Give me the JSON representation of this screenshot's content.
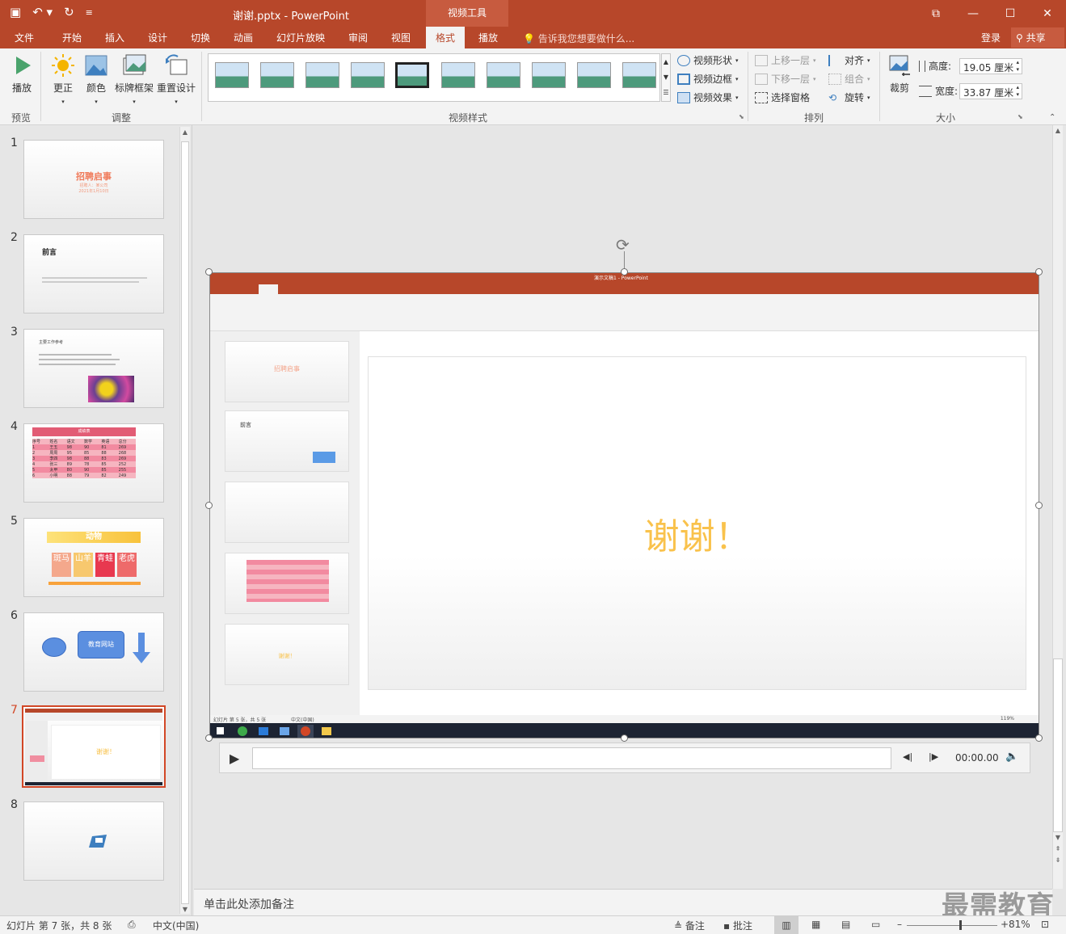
{
  "window": {
    "doc_title": "谢谢.pptx - PowerPoint",
    "context_tab_header": "视频工具",
    "quick_access": [
      "save-icon",
      "undo-icon",
      "redo-icon",
      "customize-icon"
    ],
    "controls": [
      "ribbon-display-icon",
      "minimize-icon",
      "maximize-icon",
      "close-icon"
    ]
  },
  "tabs": [
    {
      "label": "文件"
    },
    {
      "label": "开始"
    },
    {
      "label": "插入"
    },
    {
      "label": "设计"
    },
    {
      "label": "切换"
    },
    {
      "label": "动画"
    },
    {
      "label": "幻灯片放映"
    },
    {
      "label": "审阅"
    },
    {
      "label": "视图"
    },
    {
      "label": "格式",
      "active": true
    },
    {
      "label": "播放"
    }
  ],
  "tell_me": "告诉我您想要做什么...",
  "account": {
    "login": "登录",
    "share": "共享"
  },
  "ribbon": {
    "preview": {
      "play_label": "播放",
      "group": "预览"
    },
    "adjust": {
      "items": [
        {
          "label": "更正",
          "icon": "sun-icon"
        },
        {
          "label": "颜色",
          "icon": "picture-color-icon"
        },
        {
          "label": "标牌框架",
          "icon": "poster-frame-icon"
        },
        {
          "label": "重置设计",
          "icon": "reset-design-icon"
        }
      ],
      "group": "调整"
    },
    "video_styles": {
      "group": "视频样式",
      "gallery_count": 10,
      "selected_index": 4,
      "shape": "视频形状",
      "border": "视频边框",
      "effects": "视频效果"
    },
    "arrange": {
      "group": "排列",
      "bring_forward": "上移一层",
      "send_backward": "下移一层",
      "selection_pane": "选择窗格",
      "align": "对齐",
      "group_btn": "组合",
      "rotate": "旋转"
    },
    "size": {
      "group": "大小",
      "crop": "裁剪",
      "height_label": "高度:",
      "height_value": "19.05 厘米",
      "width_label": "宽度:",
      "width_value": "33.87 厘米"
    }
  },
  "thumbnails": {
    "numbers": [
      "1",
      "2",
      "3",
      "4",
      "5",
      "6",
      "7",
      "8"
    ],
    "selected": "7",
    "slide1": {
      "title": "招聘启事",
      "sub1": "招聘人：某公司",
      "sub2": "2021年1月10日"
    },
    "slide2": {
      "title": "前言"
    },
    "slide3": {
      "title": "主要工作参考"
    },
    "slide4": {
      "title": "成绩表",
      "headers": [
        "序号",
        "姓名",
        "语文",
        "数学",
        "英语",
        "总分"
      ],
      "rows": [
        [
          "1",
          "王五",
          "98",
          "90",
          "81",
          "269"
        ],
        [
          "2",
          "周周",
          "95",
          "85",
          "88",
          "268"
        ],
        [
          "3",
          "李四",
          "98",
          "88",
          "83",
          "269"
        ],
        [
          "4",
          "张三",
          "89",
          "78",
          "85",
          "252"
        ],
        [
          "5",
          "太甲",
          "80",
          "90",
          "85",
          "255"
        ],
        [
          "6",
          "小明",
          "88",
          "79",
          "82",
          "249"
        ]
      ]
    },
    "slide5": {
      "title": "动物",
      "animals": [
        "斑马",
        "山羊",
        "青蛙",
        "老虎"
      ]
    },
    "slide6": {
      "box_label": "教育网站"
    },
    "slide7": {
      "text": "谢谢！"
    }
  },
  "video": {
    "slide_text": "谢谢！",
    "mini_title": "演示文稿1 - PowerPoint",
    "mini_thumb1_title": "招聘启事",
    "mini_thumb2_title": "前言",
    "mini_thumb5_text": "谢谢！",
    "mini_status": "幻灯片 第 5 张，共 5 张",
    "mini_lang": "中文(中国)",
    "mini_zoom": "119%",
    "time": "00:00.00"
  },
  "notes_placeholder": "单击此处添加备注",
  "status": {
    "slide_info": "幻灯片 第 7 张，共 8 张",
    "language": "中文(中国)",
    "notes": "备注",
    "comments": "批注",
    "zoom": "81%",
    "zoom_fraction": 0.58
  },
  "watermark": "最需教育",
  "colors": {
    "accent": "#b7472a",
    "selection": "#d24726"
  }
}
